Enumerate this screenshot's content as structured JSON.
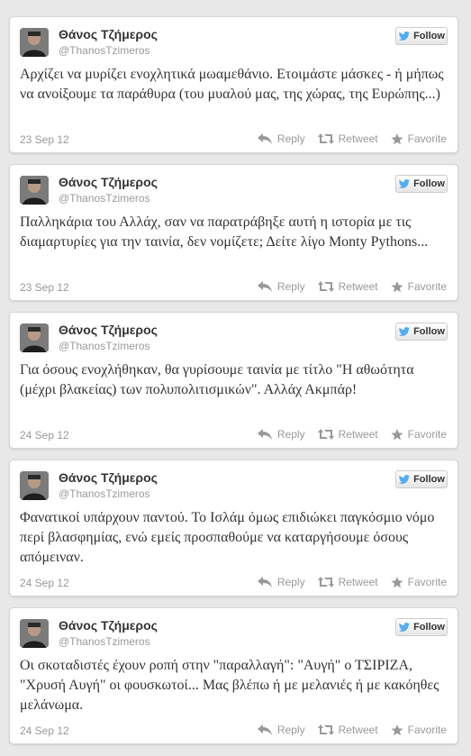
{
  "tweets": [
    {
      "name": "Θάνος Τζήμερος",
      "handle": "@ThanosTzimeros",
      "follow_label": "Follow",
      "text": "Αρχίζει να μυρίζει ενοχλητικά μωαμεθάνιο. Ετοιμάστε μάσκες - ή μήπως να ανοίξουμε τα παράθυρα (του μυαλού μας, της χώρας, της Ευρώπης...)",
      "date": "23 Sep 12",
      "reply_label": "Reply",
      "retweet_label": "Retweet",
      "favorite_label": "Favorite"
    },
    {
      "name": "Θάνος Τζήμερος",
      "handle": "@ThanosTzimeros",
      "follow_label": "Follow",
      "text": "Παλληκάρια του Αλλάχ, σαν να παρατράβηξε αυτή η ιστορία με τις διαμαρτυρίες για την ταινία, δεν νομίζετε; Δείτε λίγο Monty Pythons...",
      "date": "23 Sep 12",
      "reply_label": "Reply",
      "retweet_label": "Retweet",
      "favorite_label": "Favorite"
    },
    {
      "name": "Θάνος Τζήμερος",
      "handle": "@ThanosTzimeros",
      "follow_label": "Follow",
      "text": "Για όσους ενοχλήθηκαν, θα γυρίσουμε ταινία με τίτλο \"Η αθωότητα (μέχρι βλακείας) των πολυπολιτισμικών\". Αλλάχ Ακμπάρ!",
      "date": "24 Sep 12",
      "reply_label": "Reply",
      "retweet_label": "Retweet",
      "favorite_label": "Favorite"
    },
    {
      "name": "Θάνος Τζήμερος",
      "handle": "@ThanosTzimeros",
      "follow_label": "Follow",
      "text": "Φανατικοί υπάρχουν παντού. Το Ισλάμ όμως επιδιώκει παγκόσμιο νόμο περί βλασφημίας, ενώ εμείς προσπαθούμε να καταργήσουμε όσους απόμειναν.",
      "date": "24 Sep 12",
      "reply_label": "Reply",
      "retweet_label": "Retweet",
      "favorite_label": "Favorite"
    },
    {
      "name": "Θάνος Τζήμερος",
      "handle": "@ThanosTzimeros",
      "follow_label": "Follow",
      "text": "Οι σκοταδιστές έχουν ροπή στην \"παραλλαγή\": \"Αυγή\" ο ΤΣΙΡΙΖΑ, \"Χρυσή Αυγή\" οι φουσκωτοί... Μας βλέπω ή με μελανιές ή με κακόηθες μελάνωμα.",
      "date": "24 Sep 12",
      "reply_label": "Reply",
      "retweet_label": "Retweet",
      "favorite_label": "Favorite"
    }
  ],
  "icons": {
    "follow": "twitter-bird-icon",
    "reply": "reply-arrow-icon",
    "retweet": "retweet-icon",
    "favorite": "star-icon"
  },
  "colors": {
    "page_background": "#e8e8e8",
    "card_background": "#ffffff",
    "twitter_blue": "#55acee",
    "muted_text": "#999999",
    "body_text": "#333333"
  }
}
